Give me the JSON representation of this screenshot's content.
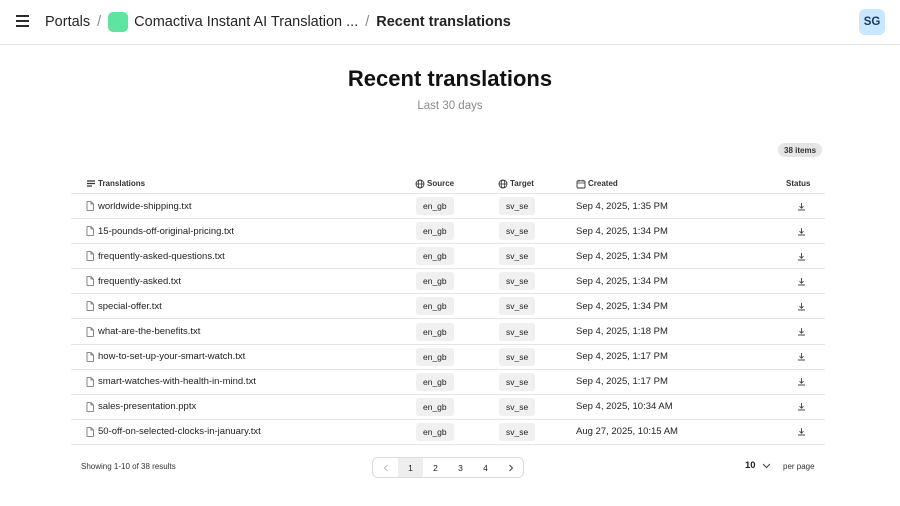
{
  "header": {
    "breadcrumbs": {
      "portals": "Portals",
      "portal_name": "Comactiva Instant AI Translation ...",
      "current": "Recent translations"
    },
    "avatar_initials": "SG",
    "portal_logo_color": "#5ee3a1",
    "avatar_color": "#c9e7ff"
  },
  "page": {
    "title": "Recent translations",
    "subtitle": "Last 30 days",
    "item_count": "38 items"
  },
  "table": {
    "columns": {
      "translations": "Translations",
      "source": "Source",
      "target": "Target",
      "created": "Created",
      "status": "Status"
    },
    "rows": [
      {
        "file": "worldwide-shipping.txt",
        "source": "en_gb",
        "target": "sv_se",
        "created": "Sep 4, 2025, 1:35 PM"
      },
      {
        "file": "15-pounds-off-original-pricing.txt",
        "source": "en_gb",
        "target": "sv_se",
        "created": "Sep 4, 2025, 1:34 PM"
      },
      {
        "file": "frequently-asked-questions.txt",
        "source": "en_gb",
        "target": "sv_se",
        "created": "Sep 4, 2025, 1:34 PM"
      },
      {
        "file": "frequently-asked.txt",
        "source": "en_gb",
        "target": "sv_se",
        "created": "Sep 4, 2025, 1:34 PM"
      },
      {
        "file": "special-offer.txt",
        "source": "en_gb",
        "target": "sv_se",
        "created": "Sep 4, 2025, 1:34 PM"
      },
      {
        "file": "what-are-the-benefits.txt",
        "source": "en_gb",
        "target": "sv_se",
        "created": "Sep 4, 2025, 1:18 PM"
      },
      {
        "file": "how-to-set-up-your-smart-watch.txt",
        "source": "en_gb",
        "target": "sv_se",
        "created": "Sep 4, 2025, 1:17 PM"
      },
      {
        "file": "smart-watches-with-health-in-mind.txt",
        "source": "en_gb",
        "target": "sv_se",
        "created": "Sep 4, 2025, 1:17 PM"
      },
      {
        "file": "sales-presentation.pptx",
        "source": "en_gb",
        "target": "sv_se",
        "created": "Sep 4, 2025, 10:34 AM"
      },
      {
        "file": "50-off-on-selected-clocks-in-january.txt",
        "source": "en_gb",
        "target": "sv_se",
        "created": "Aug 27, 2025, 10:15 AM"
      }
    ]
  },
  "footer": {
    "showing": "Showing 1-10 of 38 results",
    "pages": [
      "1",
      "2",
      "3",
      "4"
    ],
    "current_page": "1",
    "per_page_value": "10",
    "per_page_label": "per page"
  }
}
